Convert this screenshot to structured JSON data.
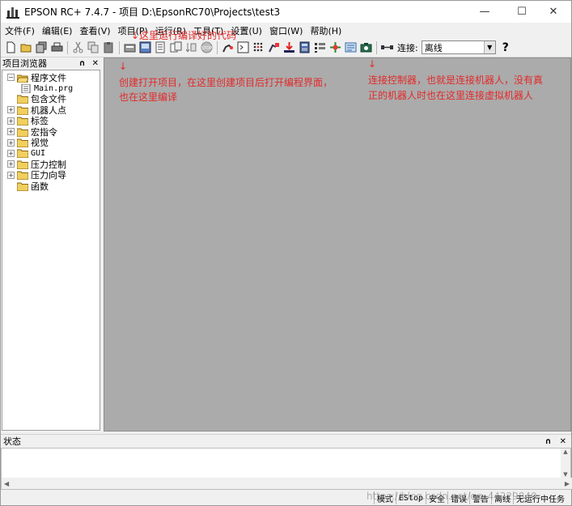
{
  "window": {
    "title": "EPSON RC+ 7.4.7 - 项目 D:\\EpsonRC70\\Projects\\test3",
    "minimize": "—",
    "maximize": "☐",
    "close": "✕"
  },
  "menu": [
    "文件(F)",
    "编辑(E)",
    "查看(V)",
    "项目(P)",
    "运行(R)",
    "工具(T)",
    "设置(U)",
    "窗口(W)",
    "帮助(H)"
  ],
  "toolbar": {
    "connection_label": "连接:",
    "connection_value": "离线",
    "help": "?"
  },
  "explorer": {
    "title": "项目浏览器",
    "pin": "∩",
    "close": "✕",
    "tree": [
      {
        "label": "程序文件",
        "expander": "−",
        "type": "folder-open"
      },
      {
        "label": "Main.prg",
        "expander": "",
        "type": "file"
      },
      {
        "label": "包含文件",
        "expander": "",
        "type": "folder"
      },
      {
        "label": "机器人点",
        "expander": "+",
        "type": "folder"
      },
      {
        "label": "标签",
        "expander": "+",
        "type": "folder"
      },
      {
        "label": "宏指令",
        "expander": "+",
        "type": "folder"
      },
      {
        "label": "视觉",
        "expander": "+",
        "type": "folder"
      },
      {
        "label": "GUI",
        "expander": "+",
        "type": "folder"
      },
      {
        "label": "压力控制",
        "expander": "+",
        "type": "folder"
      },
      {
        "label": "压力向导",
        "expander": "+",
        "type": "folder"
      },
      {
        "label": "函数",
        "expander": "",
        "type": "folder"
      }
    ]
  },
  "status_panel": {
    "title": "状态",
    "pin": "∩",
    "close": "✕"
  },
  "statusbar": [
    "模式",
    "EStop",
    "安全",
    "错误",
    "警告",
    "离线",
    "无运行中任务"
  ],
  "watermark": "https://blog.csdn.net/qq_44229840",
  "annotations": {
    "compile": "↓这里运行编译好的代码",
    "project_arrow": "↓",
    "project_note_1": "创建打开项目，在这里创建项目后打开编程界面，",
    "project_note_2": "也在这里编译",
    "connect_arrow": "↓",
    "connect_note_1": "连接控制器，也就是连接机器人，没有真",
    "connect_note_2": "正的机器人时也在这里连接虚拟机器人"
  },
  "colors": {
    "annotation": "#e32a2a",
    "mdi_background": "#ababab"
  }
}
